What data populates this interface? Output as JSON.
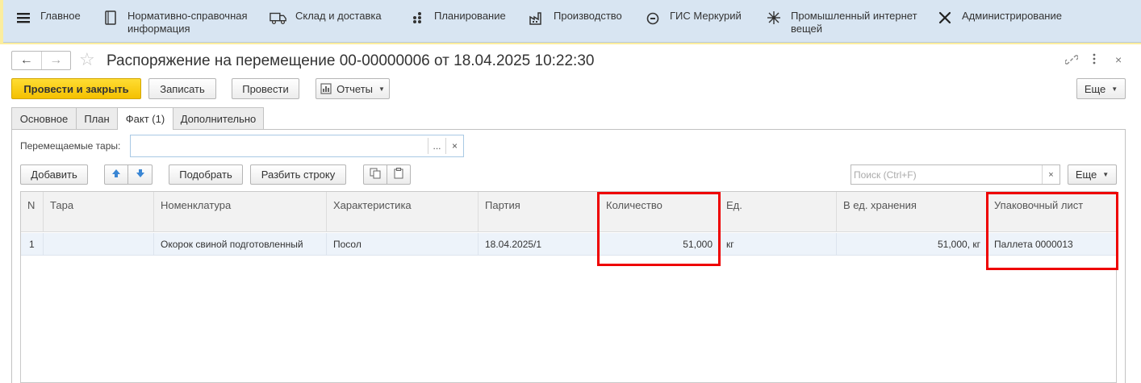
{
  "sections": [
    {
      "label": "Главное",
      "icon": "menu-icon"
    },
    {
      "label": "Нормативно-справочная\nинформация",
      "icon": "book-icon"
    },
    {
      "label": "Склад и доставка",
      "icon": "truck-icon"
    },
    {
      "label": "Планирование",
      "icon": "dots-icon"
    },
    {
      "label": "Производство",
      "icon": "factory-icon"
    },
    {
      "label": "ГИС Меркурий",
      "icon": "compass-icon"
    },
    {
      "label": "Промышленный интернет\nвещей",
      "icon": "network-icon"
    },
    {
      "label": "Администрирование",
      "icon": "tools-icon"
    }
  ],
  "document": {
    "title": "Распоряжение на перемещение 00-00000006 от 18.04.2025 10:22:30"
  },
  "toolbar": {
    "post_close": "Провести и закрыть",
    "save": "Записать",
    "post": "Провести",
    "reports": "Отчеты",
    "more": "Еще"
  },
  "tabs": [
    {
      "label": "Основное",
      "active": false
    },
    {
      "label": "План",
      "active": false
    },
    {
      "label": "Факт (1)",
      "active": true
    },
    {
      "label": "Дополнительно",
      "active": false
    }
  ],
  "field": {
    "label": "Перемещаемые тары:",
    "value": "",
    "select_label": "...",
    "clear_label": "×"
  },
  "table_toolbar": {
    "add": "Добавить",
    "pick": "Подобрать",
    "split": "Разбить строку",
    "search_placeholder": "Поиск (Ctrl+F)",
    "search_clear": "×",
    "more": "Еще"
  },
  "table": {
    "columns": [
      "N",
      "Тара",
      "Номенклатура",
      "Характеристика",
      "Партия",
      "Количество",
      "Ед.",
      "В ед. хранения",
      "Упаковочный лист"
    ],
    "rows": [
      [
        "1",
        "",
        "Окорок свиной подготовленный",
        "Посол",
        "18.04.2025/1",
        "51,000",
        "кг",
        "51,000, кг",
        "Паллета 0000013"
      ]
    ]
  },
  "colors": {
    "section_bar": "#d8e5f2",
    "primary_button": "#f4c000",
    "annotation": "#ee0000"
  }
}
